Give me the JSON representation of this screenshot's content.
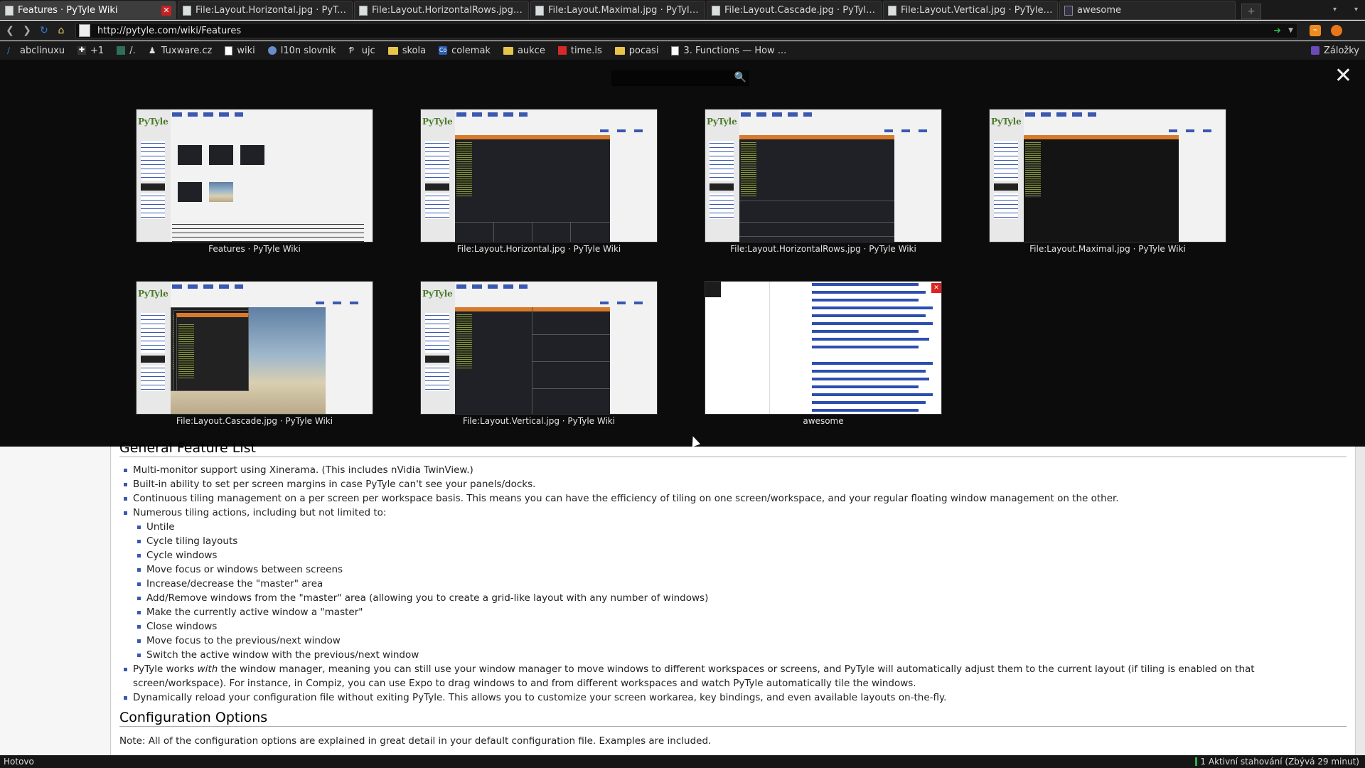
{
  "tabs": [
    {
      "label": "Features · PyTyle Wiki",
      "active": true
    },
    {
      "label": "File:Layout.Horizontal.jpg · PyTyle ..."
    },
    {
      "label": "File:Layout.HorizontalRows.jpg · Py..."
    },
    {
      "label": "File:Layout.Maximal.jpg · PyTyle Wiki"
    },
    {
      "label": "File:Layout.Cascade.jpg · PyTyle Wiki"
    },
    {
      "label": "File:Layout.Vertical.jpg · PyTyle Wiki"
    },
    {
      "label": "awesome"
    }
  ],
  "address": {
    "url": "http://pytyle.com/wiki/Features"
  },
  "bookmarks": [
    "abclinuxu",
    "+1",
    "/.",
    "Tuxware.cz",
    "wiki",
    "l10n slovnik",
    "ujc",
    "skola",
    "colemak",
    "aukce",
    "time.is",
    "pocasi",
    "3. Functions — How ..."
  ],
  "bookmarks_right": "Záložky",
  "overlay": {
    "search_value": "",
    "thumbnails": [
      "Features · PyTyle Wiki",
      "File:Layout.Horizontal.jpg · PyTyle Wiki",
      "File:Layout.HorizontalRows.jpg · PyTyle Wiki",
      "File:Layout.Maximal.jpg · PyTyle Wiki",
      "File:Layout.Cascade.jpg · PyTyle Wiki",
      "File:Layout.Vertical.jpg · PyTyle Wiki",
      "awesome"
    ]
  },
  "article": {
    "heading": "General Feature List",
    "items": [
      "Multi-monitor support using Xinerama. (This includes nVidia TwinView.)",
      "Built-in ability to set per screen margins in case PyTyle can't see your panels/docks.",
      "Continuous tiling management on a per screen per workspace basis. This means you can have the efficiency of tiling on one screen/workspace, and your regular floating window management on the other.",
      "Numerous tiling actions, including but not limited to:"
    ],
    "subitems": [
      "Untile",
      "Cycle tiling layouts",
      "Cycle windows",
      "Move focus or windows between screens",
      "Increase/decrease the \"master\" area",
      "Add/Remove windows from the \"master\" area (allowing you to create a grid-like layout with any number of windows)",
      "Make the currently active window a \"master\"",
      "Close windows",
      "Move focus to the previous/next window",
      "Switch the active window with the previous/next window"
    ],
    "item_with_before": "PyTyle works ",
    "item_with_em": "with",
    "item_with_after": " the window manager, meaning you can still use your window manager to move windows to different workspaces or screens, and PyTyle will automatically adjust them to the current layout (if tiling is enabled on that screen/workspace). For instance, in Compiz, you can use Expo to drag windows to and from different workspaces and watch PyTyle automatically tile the windows.",
    "item_last": "Dynamically reload your configuration file without exiting PyTyle. This allows you to customize your screen workarea, key bindings, and even available layouts on-the-fly.",
    "heading2": "Configuration Options",
    "note": "Note: All of the configuration options are explained in great detail in your default configuration file. Examples are included."
  },
  "status": {
    "left": "Hotovo",
    "right": "1 Aktivní stahování (Zbývá 29 minut)"
  }
}
